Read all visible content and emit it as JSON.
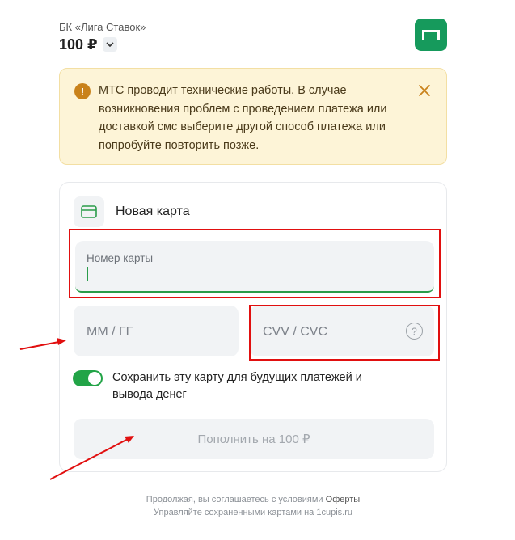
{
  "merchant": {
    "name": "БК «Лига Ставок»",
    "amount": "100 ₽"
  },
  "notice": {
    "text": "МТС проводит технические работы. В случае возникновения проблем с проведением платежа или доставкой смс выберите другой способ платежа или попробуйте повторить позже."
  },
  "card_form": {
    "title": "Новая карта",
    "card_number_label": "Номер карты",
    "expiry_placeholder": "ММ / ГГ",
    "cvv_placeholder": "CVV / CVC",
    "save_card_label": "Сохранить эту карту для будущих платежей и вывода денег",
    "save_card_enabled": true,
    "submit_label": "Пополнить на 100 ₽"
  },
  "footer": {
    "terms_prefix": "Продолжая, вы соглашаетесь с условиями",
    "terms_link": "Оферты",
    "manage_cards": "Управляйте сохраненными картами на 1cupis.ru"
  },
  "colors": {
    "brand_green": "#169a5c",
    "toggle_green": "#22a447",
    "notice_background": "#fdf4d7",
    "annotation_red": "#e10f0f"
  }
}
